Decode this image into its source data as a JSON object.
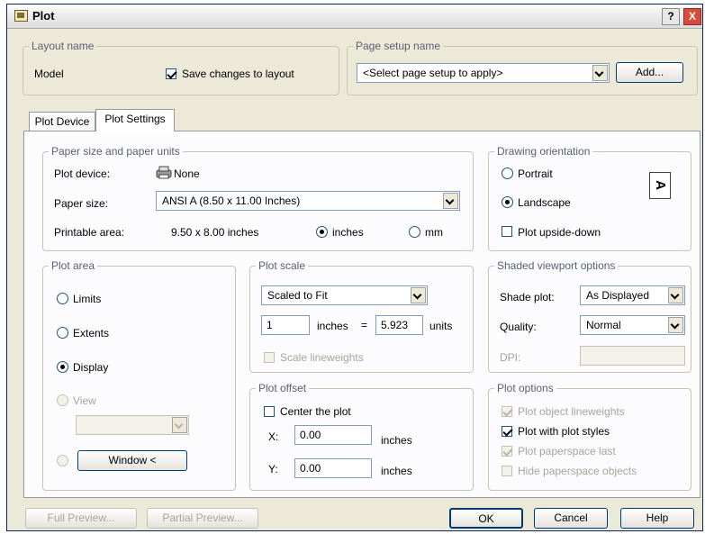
{
  "window": {
    "title": "Plot",
    "help_label": "?",
    "close_label": "X"
  },
  "layout_name": {
    "group": "Layout name",
    "value": "Model",
    "save_changes_label": "Save changes to layout",
    "save_changes_checked": true
  },
  "page_setup": {
    "group": "Page setup name",
    "select_value": "<Select page setup to apply>",
    "add_button": "Add..."
  },
  "tabs": [
    {
      "label": "Plot Device",
      "active": false
    },
    {
      "label": "Plot Settings",
      "active": true
    }
  ],
  "paper": {
    "group": "Paper size and paper units",
    "plot_device_label": "Plot device:",
    "plot_device_value": "None",
    "paper_size_label": "Paper size:",
    "paper_size_value": "ANSI A (8.50 x 11.00 Inches)",
    "printable_area_label": "Printable area:",
    "printable_area_value": "9.50 x 8.00 inches",
    "unit_inches": "inches",
    "unit_mm": "mm",
    "selected_unit": "inches"
  },
  "orientation": {
    "group": "Drawing orientation",
    "portrait": "Portrait",
    "landscape": "Landscape",
    "selected": "Landscape",
    "upside_down": "Plot upside-down",
    "upside_down_checked": false,
    "icon_letter": "A"
  },
  "plot_area": {
    "group": "Plot area",
    "limits": "Limits",
    "extents": "Extents",
    "display": "Display",
    "view": "View",
    "selected": "Display",
    "window_button": "Window <"
  },
  "plot_scale": {
    "group": "Plot scale",
    "scale_value": "Scaled to Fit",
    "inches_value": "1",
    "inches_label": "inches",
    "equals": "=",
    "units_value": "5.923",
    "units_label": "units",
    "scale_lineweights": "Scale lineweights",
    "scale_lineweights_checked": false
  },
  "plot_offset": {
    "group": "Plot offset",
    "center_label": "Center the plot",
    "center_checked": false,
    "x_label": "X:",
    "x_value": "0.00",
    "x_unit": "inches",
    "y_label": "Y:",
    "y_value": "0.00",
    "y_unit": "inches"
  },
  "shaded": {
    "group": "Shaded viewport options",
    "shade_label": "Shade plot:",
    "shade_value": "As Displayed",
    "quality_label": "Quality:",
    "quality_value": "Normal",
    "dpi_label": "DPI:",
    "dpi_value": ""
  },
  "plot_options": {
    "group": "Plot options",
    "object_lineweights": "Plot object lineweights",
    "object_lineweights_checked": true,
    "with_styles": "Plot with plot styles",
    "with_styles_checked": true,
    "paperspace_last": "Plot paperspace last",
    "paperspace_last_checked": true,
    "hide_paperspace": "Hide paperspace objects",
    "hide_paperspace_checked": false
  },
  "footer": {
    "full_preview": "Full Preview...",
    "partial_preview": "Partial Preview...",
    "ok": "OK",
    "cancel": "Cancel",
    "help": "Help"
  }
}
